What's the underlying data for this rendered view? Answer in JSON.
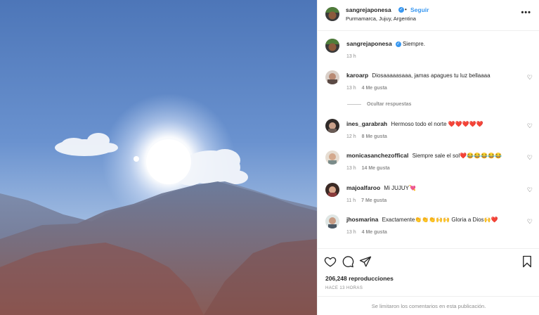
{
  "post": {
    "username": "sangrejaponesa",
    "verified_mark": "✓",
    "separator": "•",
    "follow_label": "Seguir",
    "location": "Purmamarca, Jujuy, Argentina",
    "more_icon": "more-horizontal-icon",
    "more_glyph": "•••"
  },
  "caption": {
    "username": "sangrejaponesa",
    "text": "Siempre.",
    "time": "13 h"
  },
  "comments": [
    {
      "username": "karoarp",
      "text": "Diosaaaaasaaa, jamas apagues tu luz bellaaaa",
      "time": "13 h",
      "likes": "4 Me gusta"
    },
    {
      "username": "ines_garabrah",
      "text": "Hermoso todo el norte ❤️❤️❤️❤️❤️",
      "time": "12 h",
      "likes": "8 Me gusta"
    },
    {
      "username": "monicasanchezoffical",
      "text": "Siempre sale el sol❤️😂😂😂😂😂",
      "time": "13 h",
      "likes": "14 Me gusta"
    },
    {
      "username": "majoalfaroo",
      "text": "Mi JUJUY💘",
      "time": "11 h",
      "likes": "7 Me gusta"
    },
    {
      "username": "jhosmarina",
      "text": "Exactamente👏👏👏🙌🙌 Gloria a Dios🙌❤️",
      "time": "13 h",
      "likes": "4 Me gusta"
    }
  ],
  "hide_replies_label": "Ocultar respuestas",
  "actions": {
    "views_count": "206,248",
    "views_label": "reproducciones",
    "time_ago": "HACE 13 HORAS",
    "comments_limited": "Se limitaron los comentarios en esta publicación."
  },
  "icons": [
    "heart-icon",
    "comment-icon",
    "share-icon",
    "bookmark-icon"
  ],
  "colors": {
    "accent": "#3897f0",
    "heart": "#ed4956",
    "muted": "#8e8e8e"
  }
}
